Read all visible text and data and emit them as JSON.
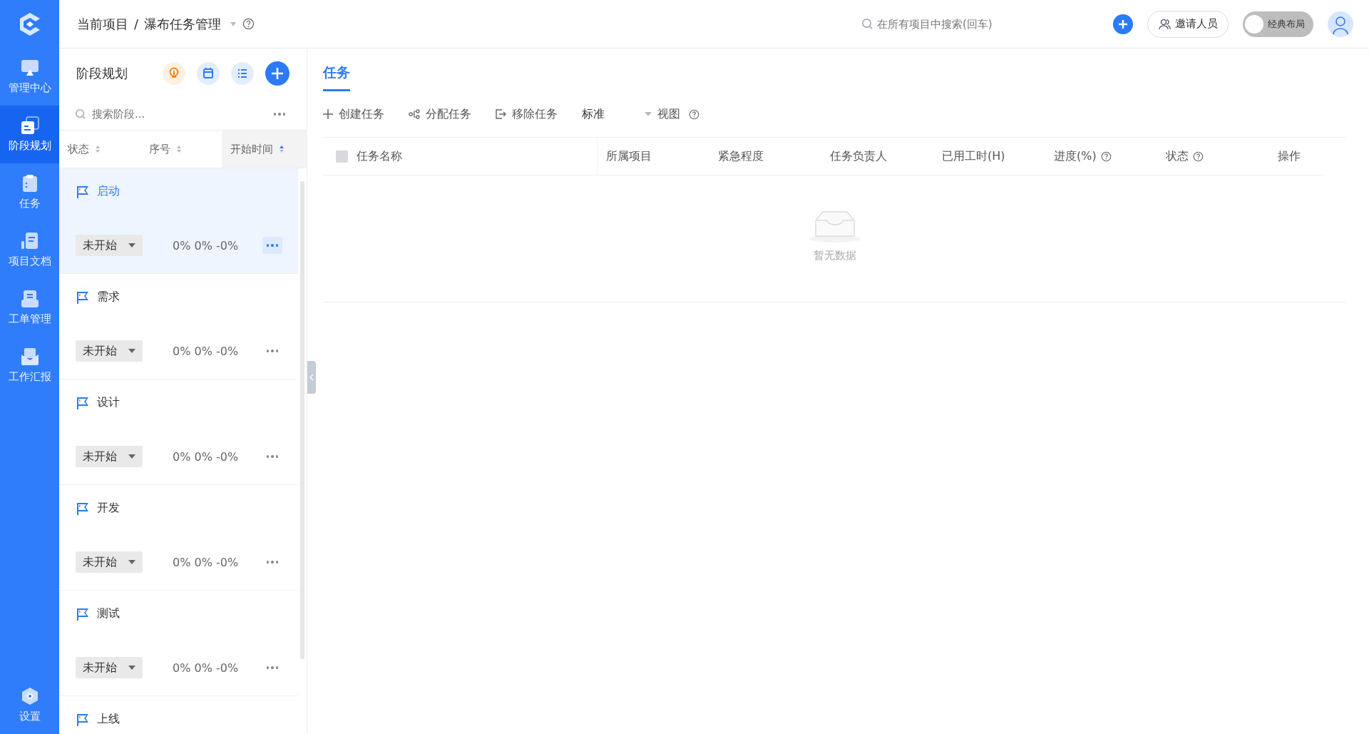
{
  "nav": {
    "items": [
      {
        "label": "管理中心",
        "selected": false
      },
      {
        "label": "阶段规划",
        "selected": true
      },
      {
        "label": "任务",
        "selected": false
      },
      {
        "label": "项目文档",
        "selected": false
      },
      {
        "label": "工单管理",
        "selected": false
      },
      {
        "label": "工作汇报",
        "selected": false
      }
    ],
    "bottom": {
      "label": "设置"
    }
  },
  "header": {
    "breadcrumb": [
      "当前项目",
      "瀑布任务管理"
    ],
    "breadcrumb_separator": "/",
    "search": {
      "placeholder": "在所有项目中搜索(回车)"
    },
    "invite": "邀请人员",
    "layout_toggle": {
      "label": "经典布局",
      "on": false
    }
  },
  "stages_panel": {
    "title": "阶段规划",
    "search": {
      "placeholder": "搜索阶段..."
    },
    "sort_columns": [
      {
        "label": "状态",
        "selected": false
      },
      {
        "label": "序号",
        "selected": false
      },
      {
        "label": "开始时间",
        "selected": true
      }
    ],
    "stages": [
      {
        "name": "启动",
        "status": "未开始",
        "progress": "0% 0% -0%",
        "selected": true
      },
      {
        "name": "需求",
        "status": "未开始",
        "progress": "0% 0% -0%",
        "selected": false
      },
      {
        "name": "设计",
        "status": "未开始",
        "progress": "0% 0% -0%",
        "selected": false
      },
      {
        "name": "开发",
        "status": "未开始",
        "progress": "0% 0% -0%",
        "selected": false
      },
      {
        "name": "测试",
        "status": "未开始",
        "progress": "0% 0% -0%",
        "selected": false
      },
      {
        "name": "上线",
        "selected": false
      }
    ]
  },
  "tasks": {
    "tabs": [
      {
        "label": "任务",
        "selected": true
      }
    ],
    "toolbar": [
      {
        "label": "创建任务"
      },
      {
        "label": "分配任务"
      },
      {
        "label": "移除任务"
      }
    ],
    "view_select": "标准",
    "view_label": "视图",
    "table": {
      "select_all_checked": false,
      "columns": [
        {
          "label": "任务名称",
          "help": false
        },
        {
          "label": "所属项目",
          "help": false
        },
        {
          "label": "紧急程度",
          "help": false
        },
        {
          "label": "任务负责人",
          "help": false
        },
        {
          "label": "已用工时(H)",
          "help": false
        },
        {
          "label": "进度(%)",
          "help": true
        },
        {
          "label": "状态",
          "help": true
        },
        {
          "label": "操作",
          "help": false
        }
      ],
      "empty_text": "暂无数据"
    }
  }
}
